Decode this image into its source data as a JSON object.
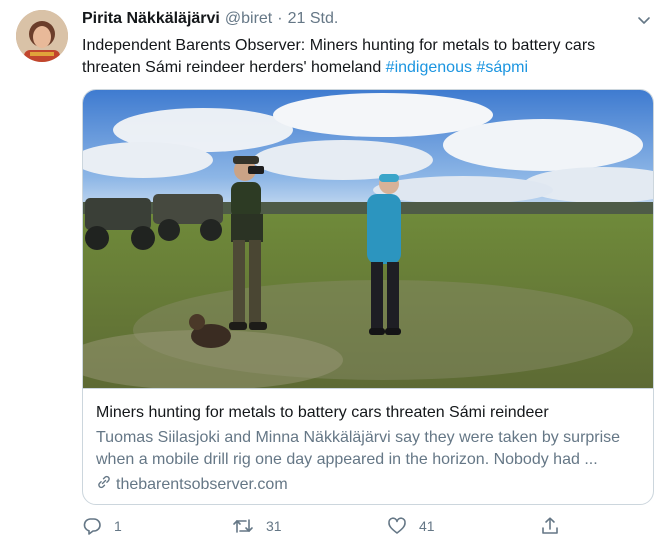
{
  "author": {
    "name": "Pirita Näkkäläjärvi",
    "handle": "@biret",
    "separator": "·",
    "time": "21 Std."
  },
  "tweet": {
    "text": "Independent Barents Observer: Miners hunting for metals to battery cars threaten Sámi reindeer herders' homeland ",
    "hashtags": [
      "#indigenous",
      "#sápmi"
    ]
  },
  "card": {
    "title": "Miners hunting for metals to battery cars threaten Sámi reindeer",
    "description": "Tuomas Siilasjoki and Minna Näkkäläjärvi say they were taken by surprise when a mobile drill rig one day appeared in the horizon. Nobody had ...",
    "domain": "thebarentsobserver.com",
    "image_icon": "photo-of-herders-on-tundra"
  },
  "actions": {
    "reply_count": "1",
    "retweet_count": "31",
    "like_count": "41"
  },
  "icons": {
    "reply": "reply-icon",
    "retweet": "retweet-icon",
    "like": "heart-icon",
    "share": "share-icon",
    "menu": "chevron-down-icon",
    "link": "link-icon"
  },
  "colors": {
    "link": "#1b95e0",
    "muted": "#657786",
    "border": "#ccd6dd"
  }
}
